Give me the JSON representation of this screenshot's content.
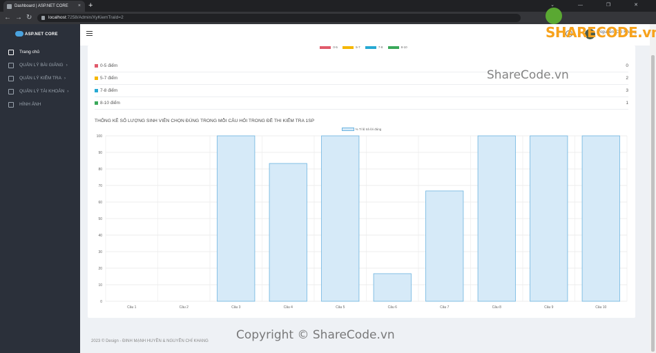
{
  "browser": {
    "tab_title": "Dashboard | ASP.NET CORE",
    "tab_close": "×",
    "new_tab": "+",
    "window_controls": "⌄ — ❐ ✕",
    "url_host": "localhost",
    "url_path": ":7258/Admin/XyKiemTraId=2"
  },
  "sidebar": {
    "brand": "ASP.NET CORE",
    "items": [
      {
        "label": "Trang chủ",
        "icon": "home-icon",
        "active": true
      },
      {
        "label": "QUẢN LÝ BÀI GIẢNG",
        "icon": "book-icon",
        "chevron": "›"
      },
      {
        "label": "QUẢN LÝ KIỂM TRA",
        "icon": "clipboard-icon",
        "chevron": "›"
      },
      {
        "label": "QUẢN LÝ TÀI KHOẢN",
        "icon": "user-icon",
        "chevron": "›"
      },
      {
        "label": "HÌNH ẢNH",
        "icon": "image-icon"
      }
    ]
  },
  "header": {
    "user_name": "Nguyễn Chí Khang"
  },
  "score_legend": [
    {
      "label": "0-5",
      "color": "#e15a6b"
    },
    {
      "label": "5-7",
      "color": "#f5b700"
    },
    {
      "label": "7-8",
      "color": "#27a9d3"
    },
    {
      "label": "8-10",
      "color": "#3aa85a"
    }
  ],
  "score_rows": [
    {
      "label": "0-5 điểm",
      "count": "0",
      "color": "#e15a6b"
    },
    {
      "label": "5-7 điểm",
      "count": "2",
      "color": "#f5b700"
    },
    {
      "label": "7-8 điểm",
      "count": "3",
      "color": "#27a9d3"
    },
    {
      "label": "8-10 điểm",
      "count": "1",
      "color": "#3aa85a"
    }
  ],
  "chart_data": {
    "type": "bar",
    "title": "THỐNG KÊ SỐ LƯỢNG SINH VIÊN CHỌN ĐÚNG TRONG MỖI CÂU HỎI TRONG ĐỀ THI KIỂM TRA 1SP",
    "categories": [
      "Câu 1",
      "Câu 2",
      "Câu 3",
      "Câu 4",
      "Câu 5",
      "Câu 6",
      "Câu 7",
      "Câu 8",
      "Câu 9",
      "Câu 10"
    ],
    "series": [
      {
        "name": "% Tỉ lệ trả lời đúng",
        "values": [
          0,
          0,
          100,
          83.3,
          100,
          16.7,
          66.7,
          100,
          100,
          100
        ]
      }
    ],
    "ylim": [
      0,
      100
    ],
    "yticks": [
      0,
      10,
      20,
      30,
      40,
      50,
      60,
      70,
      80,
      90,
      100
    ],
    "bar_fill": "#d6eaf8",
    "bar_stroke": "#6bb3e0",
    "grid": true,
    "legend_position": "top"
  },
  "footer": "2023 © Design - ĐINH MẠNH HUYỀN & NGUYỄN CHÍ KHANG",
  "watermarks": {
    "top_right": "SHARECODE.vn",
    "middle": "ShareCode.vn",
    "bottom": "Copyright © ShareCode.vn"
  }
}
